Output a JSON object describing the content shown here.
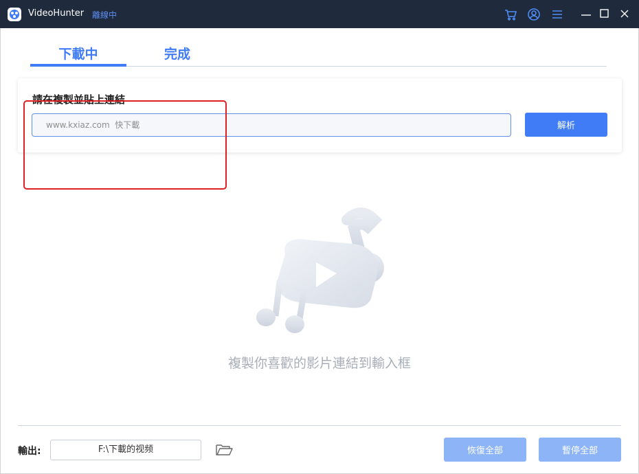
{
  "titlebar": {
    "app_name": "VideoHunter",
    "status": "離線中",
    "icons": [
      "cart-icon",
      "account-icon",
      "menu-icon",
      "minimize-icon",
      "maximize-icon",
      "close-icon"
    ]
  },
  "tabs": [
    {
      "label": "下載中",
      "active": true
    },
    {
      "label": "完成",
      "active": false
    }
  ],
  "link_card": {
    "label": "請在複製並貼上連結",
    "input_placeholder": "www.kxiaz.com  快下載",
    "input_value": "",
    "parse_button": "解析"
  },
  "empty_state": {
    "hint": "複製你喜歡的影片連結到輸入框",
    "illustration": "video-music-icon"
  },
  "footer": {
    "output_label": "輸出:",
    "output_path": "F:\\下載的视频",
    "folder_icon": "folder-icon",
    "resume_all": "恢復全部",
    "pause_all": "暫停全部"
  },
  "colors": {
    "titlebar_bg": "#1f2a3d",
    "accent": "#3f7cf6",
    "accent_disabled": "#8eb4f8",
    "status": "#5b8ef0",
    "highlight": "#e02020",
    "hint_text": "#a8aeb8"
  }
}
